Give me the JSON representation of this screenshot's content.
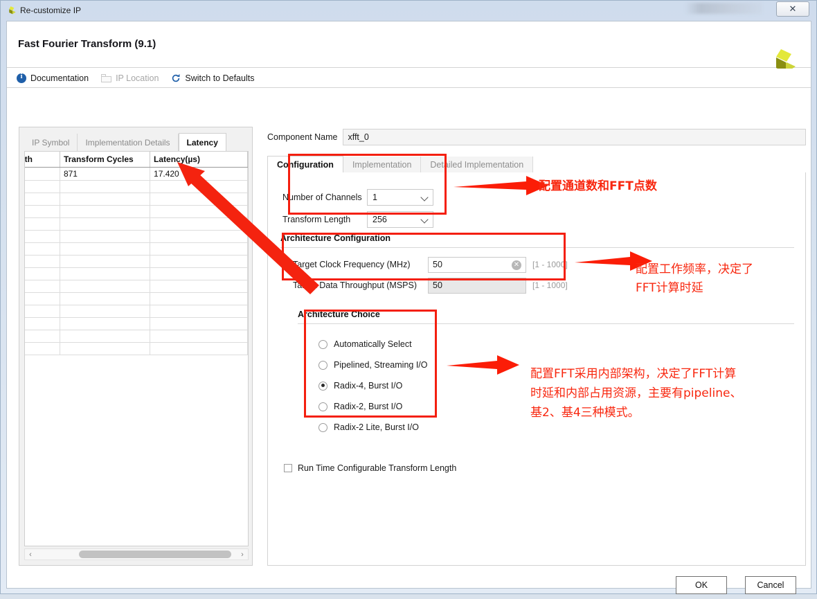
{
  "window": {
    "title": "Re-customize IP",
    "close_label": "✕",
    "logo_icon": "xilinx-logo-icon"
  },
  "header": {
    "title": "Fast Fourier Transform (9.1)",
    "logo_icon": "xilinx-logo-icon"
  },
  "toolbar": {
    "items": [
      {
        "label": "Documentation",
        "icon": "info-icon",
        "disabled": false
      },
      {
        "label": "IP Location",
        "icon": "folder-icon",
        "disabled": true
      },
      {
        "label": "Switch to Defaults",
        "icon": "refresh-icon",
        "disabled": false
      }
    ]
  },
  "left_panel": {
    "tabs": [
      {
        "label": "IP Symbol",
        "active": false
      },
      {
        "label": "Implementation Details",
        "active": false
      },
      {
        "label": "Latency",
        "active": true
      }
    ],
    "table": {
      "columns": [
        "m Length",
        "Transform Cycles",
        "Latency(µs)"
      ],
      "rows": [
        [
          "",
          "871",
          "17.420"
        ],
        [
          "",
          "",
          ""
        ],
        [
          "",
          "",
          ""
        ],
        [
          "",
          "",
          ""
        ],
        [
          "",
          "",
          ""
        ],
        [
          "",
          "",
          ""
        ],
        [
          "",
          "",
          ""
        ],
        [
          "",
          "",
          ""
        ],
        [
          "",
          "",
          ""
        ],
        [
          "",
          "",
          ""
        ],
        [
          "",
          "",
          ""
        ],
        [
          "",
          "",
          ""
        ],
        [
          "",
          "",
          ""
        ],
        [
          "",
          "",
          ""
        ],
        [
          "",
          "",
          ""
        ]
      ]
    },
    "scrollbar": {
      "left_arrow": "‹",
      "right_arrow": "›"
    }
  },
  "main": {
    "component_name_label": "Component Name",
    "component_name_value": "xfft_0",
    "tabs": [
      {
        "label": "Configuration",
        "active": true
      },
      {
        "label": "Implementation",
        "active": false
      },
      {
        "label": "Detailed Implementation",
        "active": false
      }
    ],
    "fields": {
      "number_of_channels_label": "Number of Channels",
      "number_of_channels_value": "1",
      "transform_length_label": "Transform Length",
      "transform_length_value": "256"
    },
    "architecture_configuration": {
      "heading": "Architecture Configuration",
      "clock_label": "Target Clock Frequency (MHz)",
      "clock_value": "50",
      "clock_range": "[1 - 1000]",
      "throughput_label": "Target Data Throughput (MSPS)",
      "throughput_value": "50",
      "throughput_range": "[1 - 1000]",
      "clear_icon": "clear-icon"
    },
    "architecture_choice": {
      "heading": "Architecture Choice",
      "options": [
        {
          "label": "Automatically Select",
          "selected": false
        },
        {
          "label": "Pipelined, Streaming I/O",
          "selected": false
        },
        {
          "label": "Radix-4, Burst I/O",
          "selected": true
        },
        {
          "label": "Radix-2, Burst I/O",
          "selected": false
        },
        {
          "label": "Radix-2 Lite, Burst I/O",
          "selected": false
        }
      ]
    },
    "runtime_checkbox": {
      "label": "Run Time Configurable Transform Length",
      "checked": false
    }
  },
  "footer": {
    "ok_label": "OK",
    "cancel_label": "Cancel"
  },
  "annotations": {
    "color": "#f8270f",
    "note_channels": "配置通道数和FFT点数",
    "note_clock_line1": "配置工作频率，决定了",
    "note_clock_line2": "FFT计算时延",
    "note_arch_line1": "配置FFT采用内部架构，决定了FFT计算",
    "note_arch_line2": "时延和内部占用资源，主要有pipeline、",
    "note_arch_line3": "基2、基4三种模式。"
  }
}
